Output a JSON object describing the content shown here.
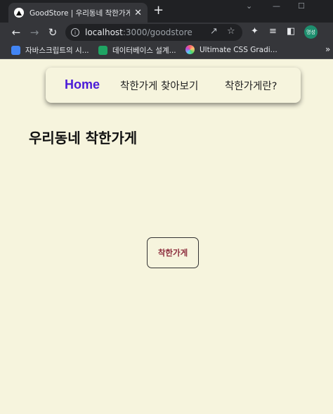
{
  "browser": {
    "tab": {
      "title": "GoodStore | 우리동네 착한가게",
      "close": "✕"
    },
    "new_tab": "+",
    "window_controls": {
      "dropdown": "⌄",
      "minimize": "—",
      "maximize": "☐"
    },
    "url": {
      "host": "localhost",
      "rest": ":3000/goodstore"
    },
    "profile_label": "명성",
    "bookmarks": [
      {
        "label": "자바스크립트의 시...",
        "icon": "js-bookmark-icon",
        "color": "#4285f4"
      },
      {
        "label": "데이터베이스 설계...",
        "icon": "db-bookmark-icon",
        "color": "#1fa463"
      },
      {
        "label": "Ultimate CSS Gradi...",
        "icon": "gradient-bookmark-icon",
        "color": "#c04ad6"
      }
    ],
    "bookmarks_more": "»"
  },
  "nav": {
    "home": "Home",
    "find": "착한가게 찾아보기",
    "about": "착한가게란?"
  },
  "page": {
    "title": "우리동네 착한가게",
    "button": "착한가게"
  },
  "colors": {
    "background": "#f6f4dd",
    "home_link": "#4a1bd8",
    "button_text": "#8b2a3a"
  }
}
